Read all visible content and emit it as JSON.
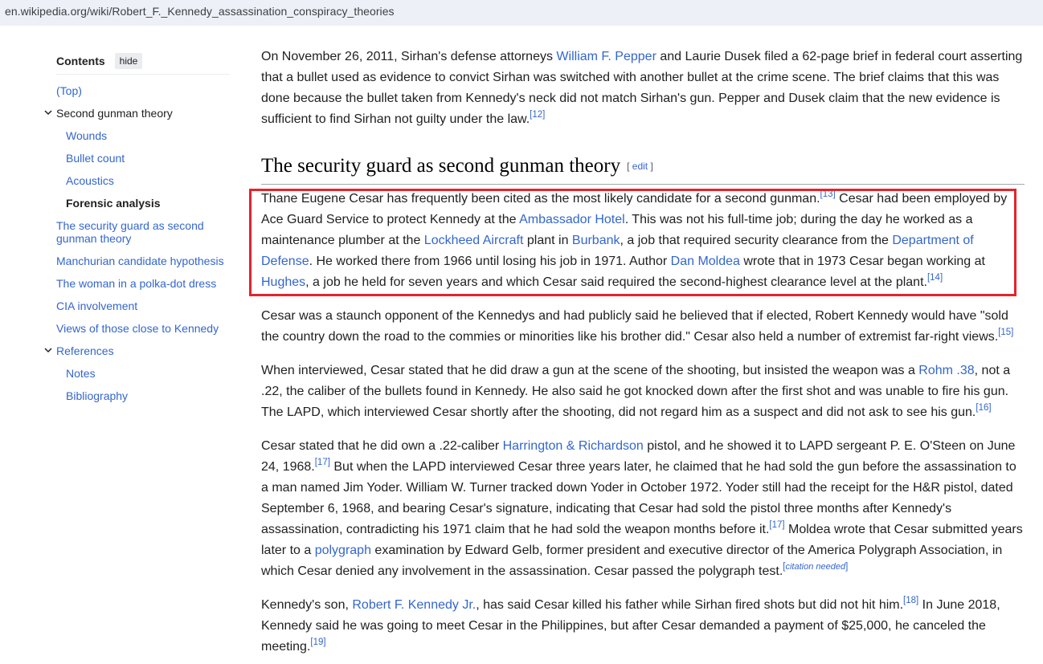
{
  "url": "en.wikipedia.org/wiki/Robert_F._Kennedy_assassination_conspiracy_theories",
  "toc": {
    "title": "Contents",
    "hide_label": "hide",
    "items": [
      {
        "label": "(Top)"
      },
      {
        "label": "Second gunman theory"
      },
      {
        "label": "Wounds"
      },
      {
        "label": "Bullet count"
      },
      {
        "label": "Acoustics"
      },
      {
        "label": "Forensic analysis"
      },
      {
        "label": "The security guard as second gunman theory"
      },
      {
        "label": "Manchurian candidate hypothesis"
      },
      {
        "label": "The woman in a polka-dot dress"
      },
      {
        "label": "CIA involvement"
      },
      {
        "label": "Views of those close to Kennedy"
      },
      {
        "label": "References"
      },
      {
        "label": "Notes"
      },
      {
        "label": "Bibliography"
      }
    ]
  },
  "heading": {
    "title": "The security guard as second gunman theory",
    "edit_open": "[ ",
    "edit_label": "edit",
    "edit_close": " ]"
  },
  "p1": {
    "t1": "On November 26, 2011, Sirhan's defense attorneys ",
    "l1": "William F. Pepper",
    "t2": " and Laurie Dusek filed a 62-page brief in federal court asserting that a bullet used as evidence to convict Sirhan was switched with another bullet at the crime scene. The brief claims that this was done because the bullet taken from Kennedy's neck did not match Sirhan's gun. Pepper and Dusek claim that the new evidence is sufficient to find Sirhan not guilty under the law.",
    "ref1": "[12]"
  },
  "p2": {
    "t1": "Thane Eugene Cesar has frequently been cited as the most likely candidate for a second gunman.",
    "ref1": "[13]",
    "t2": " Cesar had been employed by Ace Guard Service to protect Kennedy at the ",
    "l1": "Ambassador Hotel",
    "t3": ". This was not his full-time job; during the day he worked as a maintenance plumber at the ",
    "l2": "Lockheed Aircraft",
    "t4": " plant in ",
    "l3": "Burbank",
    "t5": ", a job that required security clearance from the ",
    "l4": "Department of Defense",
    "t6": ". He worked there from 1966 until losing his job in 1971. Author ",
    "l5": "Dan Moldea",
    "t7": " wrote that in 1973 Cesar began working at ",
    "l6": "Hughes",
    "t8": ", a job he held for seven years and which Cesar said required the second-highest clearance level at the plant.",
    "ref2": "[14]"
  },
  "p3": {
    "t1": "Cesar was a staunch opponent of the Kennedys and had publicly said he believed that if elected, Robert Kennedy would have \"sold the country down the road to the commies or minorities like his brother did.\" Cesar also held a number of extremist far-right views.",
    "ref1": "[15]"
  },
  "p4": {
    "t1": "When interviewed, Cesar stated that he did draw a gun at the scene of the shooting, but insisted the weapon was a ",
    "l1": "Rohm .38",
    "t2": ", not a .22, the caliber of the bullets found in Kennedy. He also said he got knocked down after the first shot and was unable to fire his gun. The LAPD, which interviewed Cesar shortly after the shooting, did not regard him as a suspect and did not ask to see his gun.",
    "ref1": "[16]"
  },
  "p5": {
    "t1": "Cesar stated that he did own a .22-caliber ",
    "l1": "Harrington & Richardson",
    "t2": " pistol, and he showed it to LAPD sergeant P. E. O'Steen on June 24, 1968.",
    "ref1": "[17]",
    "t3": " But when the LAPD interviewed Cesar three years later, he claimed that he had sold the gun before the assassination to a man named Jim Yoder. William W. Turner tracked down Yoder in October 1972. Yoder still had the receipt for the H&R pistol, dated September 6, 1968, and bearing Cesar's signature, indicating that Cesar had sold the pistol three months after Kennedy's assassination, contradicting his 1971 claim that he had sold the weapon months before it.",
    "ref2": "[17]",
    "t4": " Moldea wrote that Cesar submitted years later to a ",
    "l2": "polygraph",
    "t5": " examination by Edward Gelb, former president and executive director of the America Polygraph Association, in which Cesar denied any involvement in the assassination. Cesar passed the polygraph test.",
    "cn_open": "[",
    "cn": "citation needed",
    "cn_close": "]"
  },
  "p6": {
    "t1": "Kennedy's son, ",
    "l1": "Robert F. Kennedy Jr.",
    "t2": ", has said Cesar killed his father while Sirhan fired shots but did not hit him.",
    "ref1": "[18]",
    "t3": " In June 2018, Kennedy said he was going to meet Cesar in the Philippines, but after Cesar demanded a payment of $25,000, he canceled the meeting.",
    "ref2": "[19]"
  },
  "colors": {
    "link": "#3366cc",
    "highlight_border": "#e3242b",
    "text": "#202122"
  }
}
